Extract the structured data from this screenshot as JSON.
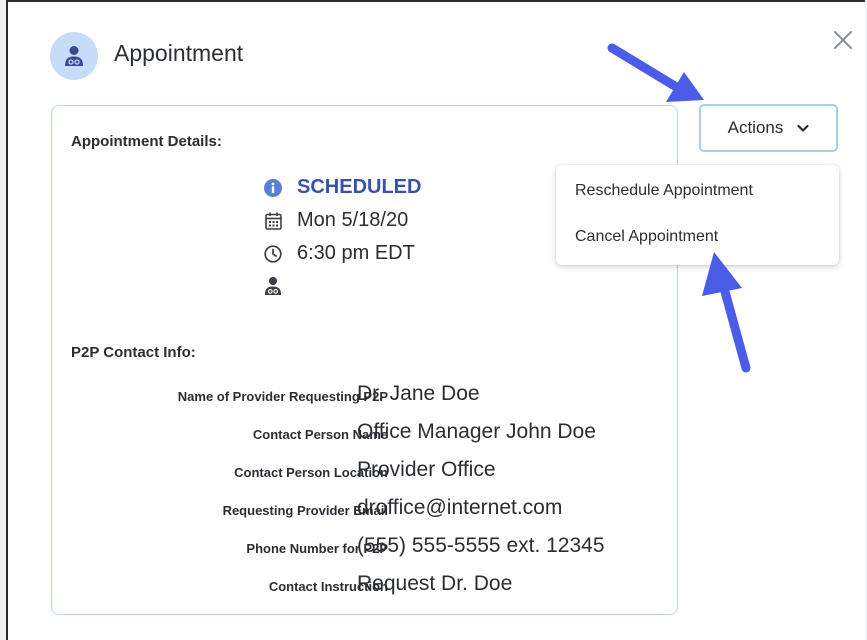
{
  "dialog": {
    "title": "Appointment",
    "close_icon": "close-icon",
    "accent_color": "#3852a8",
    "header_icon_bg": "#c7dcfa"
  },
  "appointment_details": {
    "heading": "Appointment Details:",
    "status": "SCHEDULED",
    "date": "Mon 5/18/20",
    "time": "6:30 pm EDT",
    "icons": [
      "info-icon",
      "calendar-icon",
      "clock-icon",
      "doctor-icon"
    ]
  },
  "p2p_contact": {
    "heading": "P2P Contact Info:",
    "rows": [
      {
        "label": "Name of Provider Requesting P2P",
        "value": "Dr. Jane Doe"
      },
      {
        "label": "Contact Person Name",
        "value": "Office Manager John Doe"
      },
      {
        "label": "Contact Person Location",
        "value": "Provider Office"
      },
      {
        "label": "Requesting Provider Email",
        "value": "droffice@internet.com"
      },
      {
        "label": "Phone Number for P2P",
        "value": "(555) 555-5555 ext. 12345"
      },
      {
        "label": "Contact Instruction",
        "value": "Request Dr. Doe"
      }
    ]
  },
  "actions": {
    "label": "Actions",
    "menu": [
      {
        "label": "Reschedule Appointment"
      },
      {
        "label": "Cancel Appointment"
      }
    ]
  },
  "annotation_arrow_color": "#4a5ce8"
}
